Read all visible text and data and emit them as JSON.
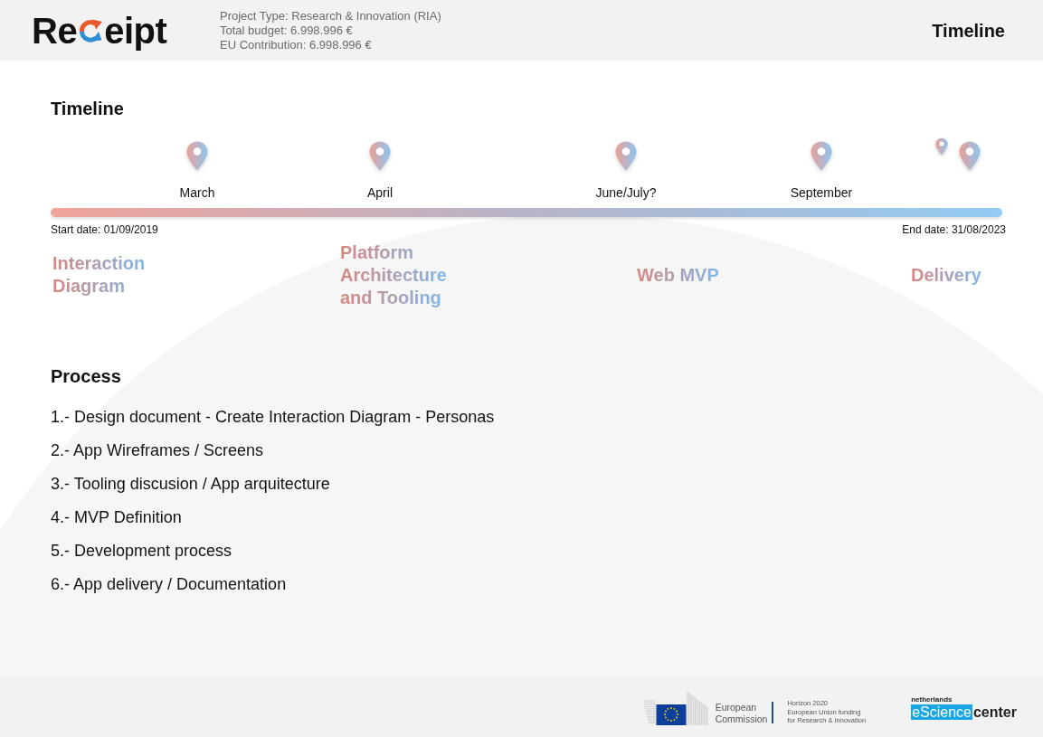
{
  "header": {
    "logo": {
      "text_start": "Re",
      "text_end": "eipt"
    },
    "project_info": [
      "Project Type: Research & Innovation (RIA)",
      "Total budget: 6.998.996 €",
      "EU Contribution: 6.998.996 €"
    ],
    "page_title": "Timeline"
  },
  "timeline": {
    "title": "Timeline",
    "markers": [
      {
        "kind": "pin",
        "label": "March"
      },
      {
        "kind": "pin",
        "label": "April"
      },
      {
        "kind": "pin",
        "label": "June/July?"
      },
      {
        "kind": "pin",
        "label": "September"
      },
      {
        "kind": "pin_pair"
      }
    ],
    "start_date": "Start date: 01/09/2019",
    "end_date": "End date: 31/08/2023",
    "milestones": [
      {
        "lines": [
          "Interaction",
          "Diagram"
        ]
      },
      {
        "lines": [
          "Platform",
          "Architecture",
          "and Tooling"
        ]
      },
      {
        "lines": [
          "Web MVP"
        ]
      },
      {
        "lines": [
          "Delivery"
        ]
      }
    ]
  },
  "process": {
    "title": "Process",
    "steps": [
      "1.- Design document - Create Interaction Diagram - Personas",
      "2.- App Wireframes / Screens",
      "3.- Tooling discusion / App arquitecture",
      "4.- MVP Definition",
      "5.- Development process",
      "6.- App delivery / Documentation"
    ]
  },
  "footer": {
    "commission": [
      "European",
      "Commission"
    ],
    "programme": [
      "Horizon 2020",
      "European Union funding",
      "for Research & Innovation"
    ],
    "partner": {
      "region": "netherlands",
      "highlight": "eScience",
      "rest": "center"
    }
  }
}
